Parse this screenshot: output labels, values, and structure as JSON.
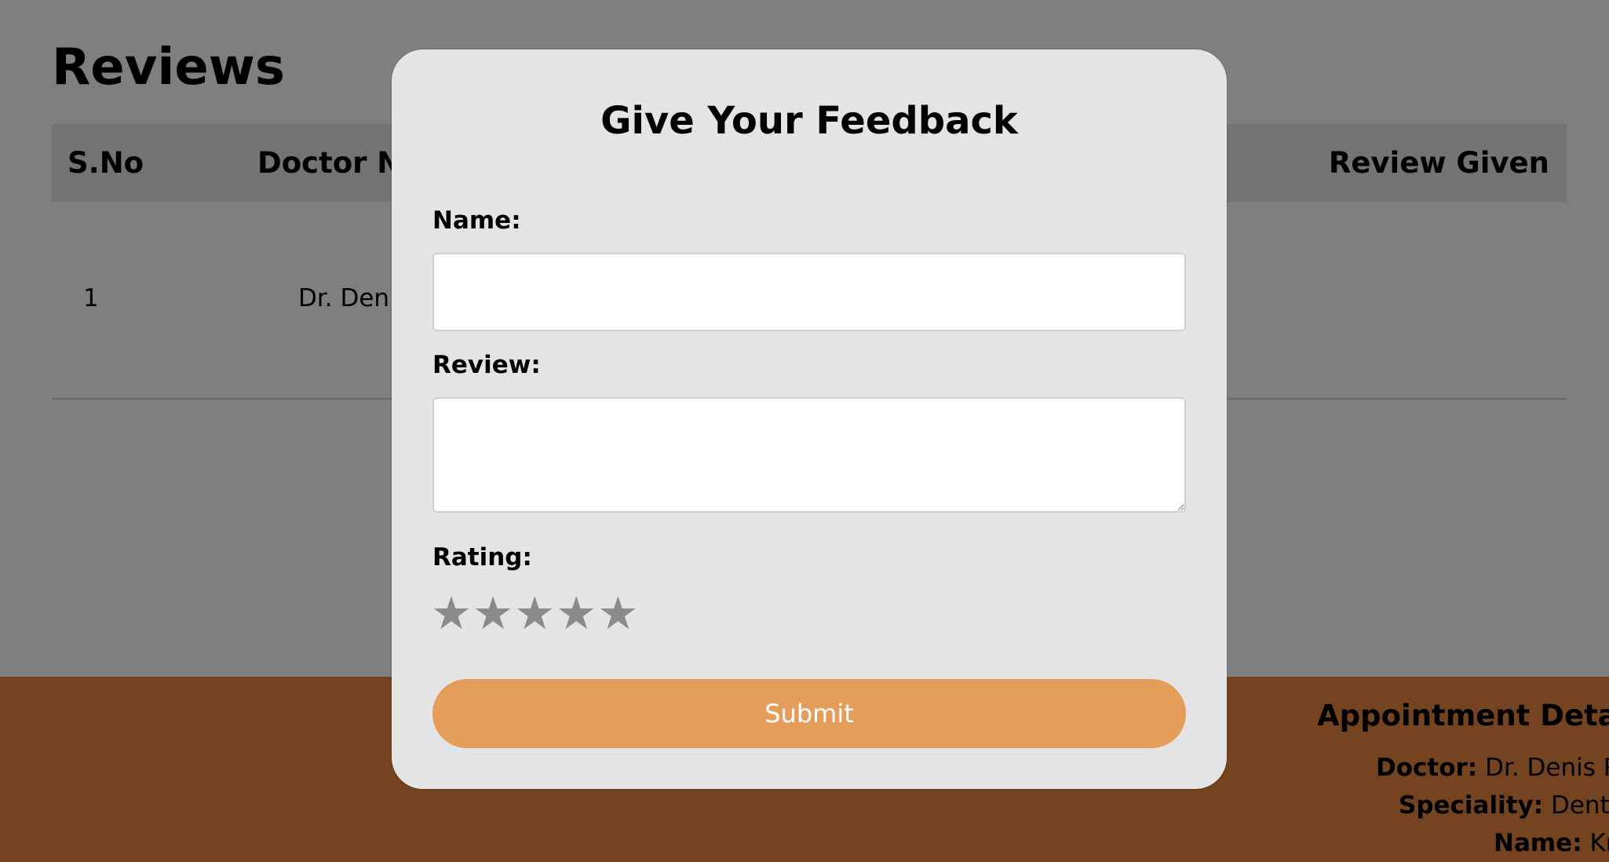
{
  "page": {
    "title": "Reviews"
  },
  "table": {
    "headers": {
      "sno": "S.No",
      "doctor": "Doctor N",
      "review": "Review Given"
    },
    "rows": [
      {
        "sno": "1",
        "doctor": "Dr. Deni"
      }
    ]
  },
  "footer": {
    "appointment": {
      "title": "Appointment Detai",
      "doctor_label": "Doctor:",
      "doctor_value": "Dr. Denis R",
      "speciality_label": "Speciality:",
      "speciality_value": "Denti",
      "name_label": "Name:",
      "name_value": "Kr"
    }
  },
  "modal": {
    "title": "Give Your Feedback",
    "name_label": "Name:",
    "name_value": "",
    "review_label": "Review:",
    "review_value": "",
    "rating_label": "Rating:",
    "rating": {
      "value": 0,
      "max": 5,
      "star_glyph": "★",
      "star_color": "#8a8a8a"
    },
    "submit_label": "Submit"
  },
  "colors": {
    "overlay": "rgba(0,0,0,0.5)",
    "footer": "#e6883f",
    "submit": "#e59d5a",
    "modal_bg": "#e4e4e4"
  }
}
